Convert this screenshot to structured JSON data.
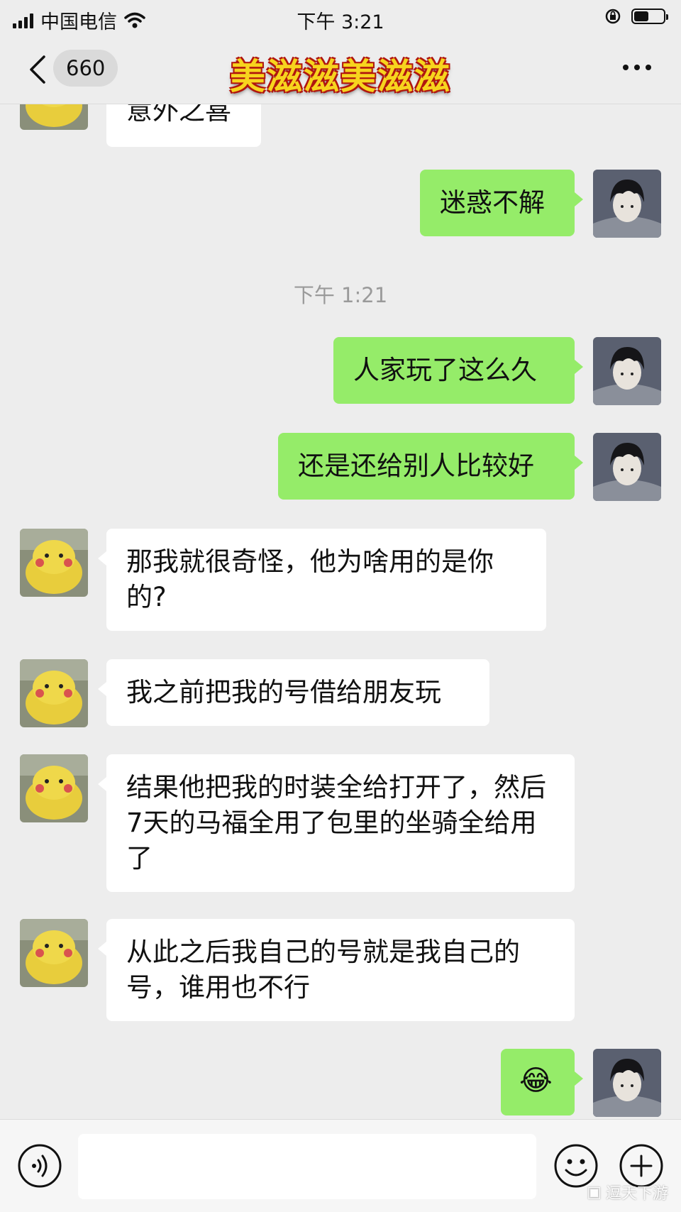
{
  "status": {
    "carrier": "中国电信",
    "time": "下午 3:21"
  },
  "nav": {
    "unread_count": "660",
    "title": "美滋滋美滋滋"
  },
  "messages": [
    {
      "side": "in",
      "text": "意外之喜"
    },
    {
      "side": "out",
      "text": "迷惑不解"
    },
    {
      "type": "time",
      "text": "下午 1:21"
    },
    {
      "side": "out",
      "text": "人家玩了这么久"
    },
    {
      "side": "out",
      "text": "还是还给别人比较好"
    },
    {
      "side": "in",
      "text": "那我就很奇怪，他为啥用的是你的?"
    },
    {
      "side": "in",
      "text": "我之前把我的号借给朋友玩"
    },
    {
      "side": "in",
      "text": "结果他把我的时装全给打开了，然后7天的马福全用了包里的坐骑全给用了"
    },
    {
      "side": "in",
      "text": "从此之后我自己的号就是我自己的号，谁用也不行"
    },
    {
      "side": "out",
      "text": "😂"
    }
  ],
  "input": {
    "value": ""
  },
  "watermark": "逗天下游"
}
